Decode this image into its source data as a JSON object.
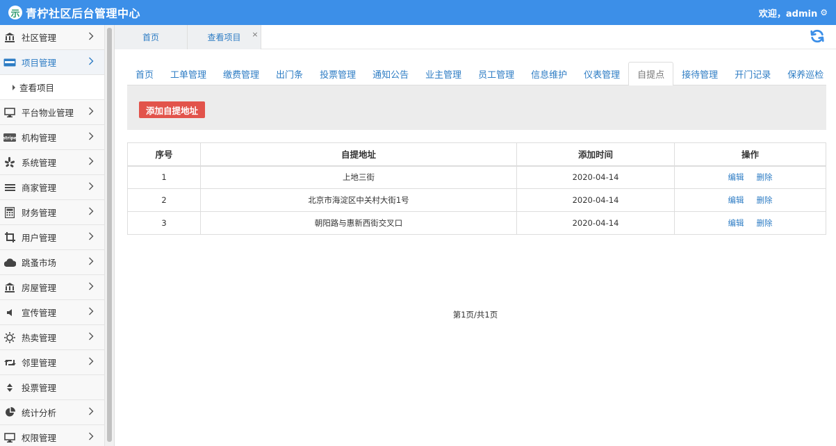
{
  "app": {
    "logo_glyph": "示",
    "title": "青柠社区后台管理中心",
    "welcome": "欢迎，admin",
    "gear_glyph": "⚙"
  },
  "sidebar": {
    "items": [
      {
        "label": "社区管理",
        "icon": "bank-icon"
      },
      {
        "label": "项目管理",
        "icon": "card-icon",
        "active": true
      },
      {
        "label": "平台物业管理",
        "icon": "monitor-icon"
      },
      {
        "label": "机构管理",
        "icon": "stripe-icon"
      },
      {
        "label": "系统管理",
        "icon": "yelp-icon"
      },
      {
        "label": "商家管理",
        "icon": "list-icon"
      },
      {
        "label": "财务管理",
        "icon": "calculator-icon"
      },
      {
        "label": "用户管理",
        "icon": "crop-icon"
      },
      {
        "label": "跳蚤市场",
        "icon": "cloud-icon"
      },
      {
        "label": "房屋管理",
        "icon": "bank-icon"
      },
      {
        "label": "宣传管理",
        "icon": "volume-icon"
      },
      {
        "label": "热卖管理",
        "icon": "sun-icon"
      },
      {
        "label": "邻里管理",
        "icon": "retweet-icon"
      },
      {
        "label": "投票管理",
        "icon": "sort-icon"
      },
      {
        "label": "统计分析",
        "icon": "pie-chart-icon"
      },
      {
        "label": "权限管理",
        "icon": "monitor-icon"
      }
    ],
    "sub_item": "查看项目"
  },
  "page_tabs": [
    {
      "label": "首页"
    },
    {
      "label": "查看项目"
    }
  ],
  "close_glyph": "×",
  "nav_tabs": [
    "首页",
    "工单管理",
    "缴费管理",
    "出门条",
    "投票管理",
    "通知公告",
    "业主管理",
    "员工管理",
    "信息维护",
    "仪表管理",
    "自提点",
    "接待管理",
    "开门记录",
    "保养巡检"
  ],
  "active_nav_index": 10,
  "toolbar": {
    "add_label": "添加自提地址"
  },
  "table": {
    "headers": [
      "序号",
      "自提地址",
      "添加时间",
      "操作"
    ],
    "rows": [
      {
        "no": "1",
        "address": "上地三街",
        "date": "2020-04-14"
      },
      {
        "no": "2",
        "address": "北京市海淀区中关村大街1号",
        "date": "2020-04-14"
      },
      {
        "no": "3",
        "address": "朝阳路与惠新西街交叉口",
        "date": "2020-04-14"
      }
    ],
    "edit_label": "编辑",
    "delete_label": "删除"
  },
  "pager": {
    "text": "第1页/共1页"
  },
  "colors": {
    "topbar": "#3c8fe8",
    "link": "#2d7cc4",
    "danger": "#e2534b"
  }
}
